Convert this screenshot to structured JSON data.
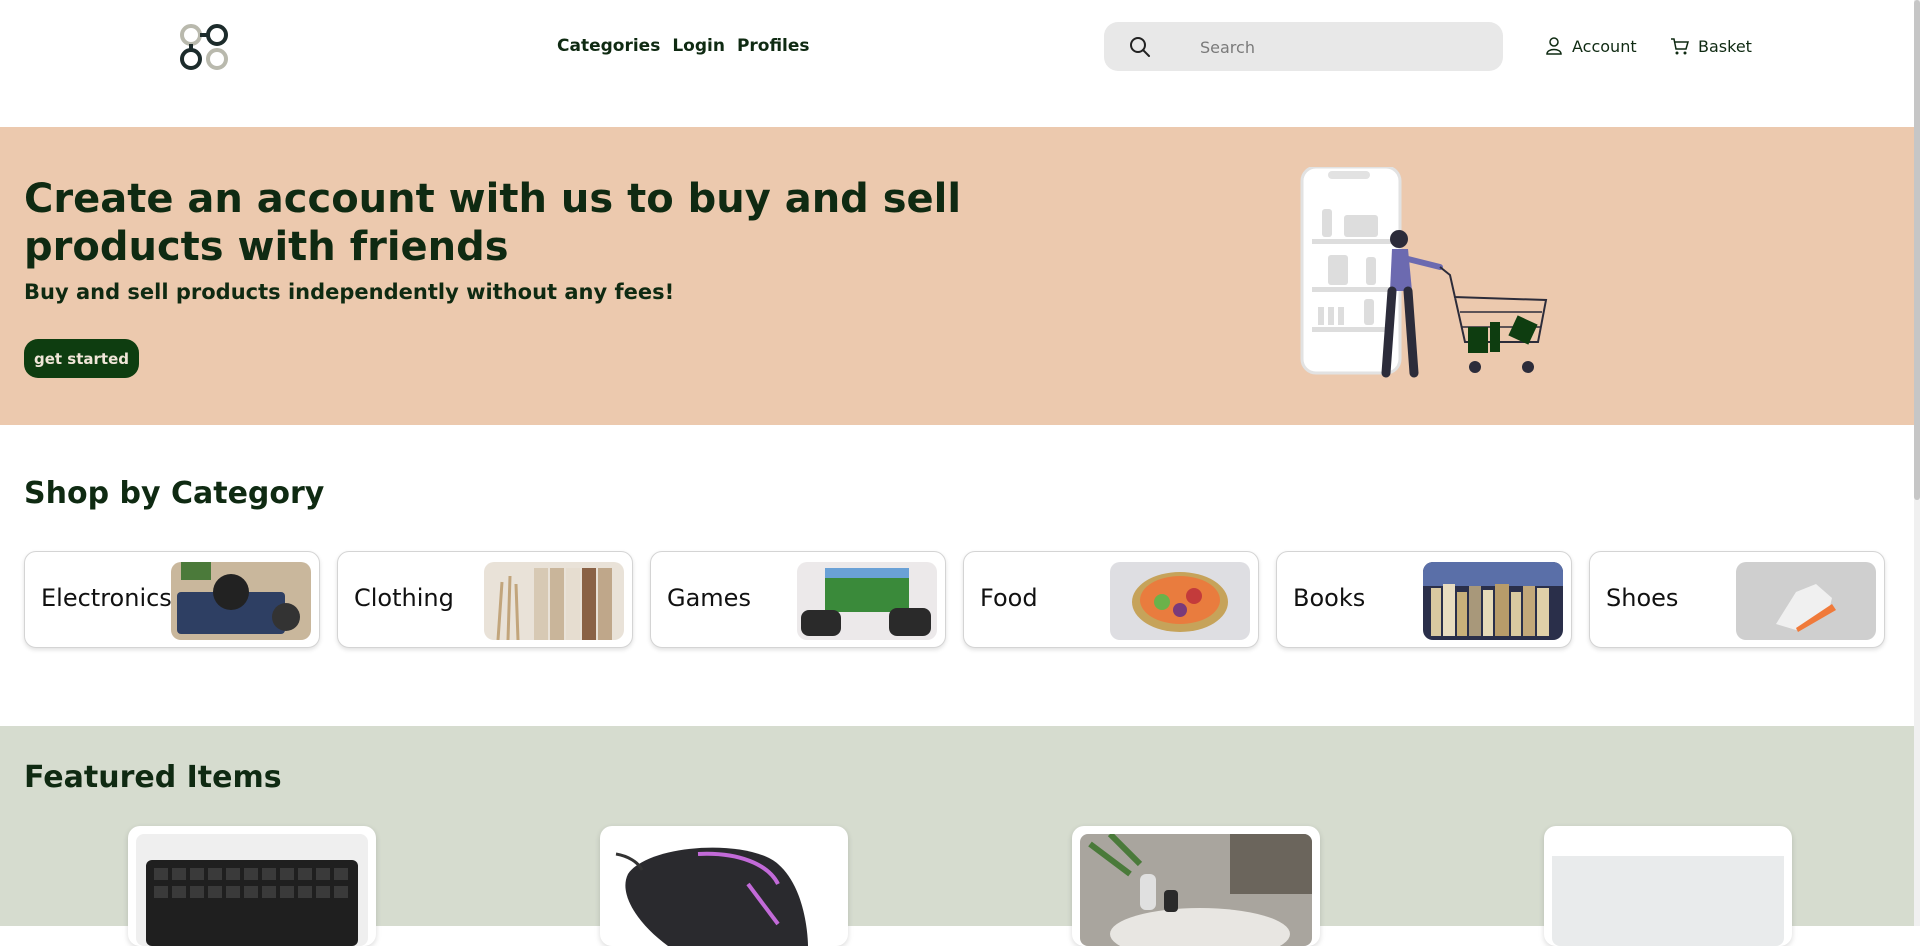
{
  "header": {
    "nav": [
      "Categories",
      "Login",
      "Profiles"
    ],
    "search": {
      "placeholder": "Search",
      "value": ""
    },
    "account_label": "Account",
    "basket_label": "Basket"
  },
  "hero": {
    "title": "Create an account with us to buy and sell products with friends",
    "subtitle": "Buy and sell products independently without any fees!",
    "cta_label": "get started"
  },
  "categories": {
    "title": "Shop by Category",
    "items": [
      {
        "label": "Electronics",
        "image": "headphones-keyboard-photo"
      },
      {
        "label": "Clothing",
        "image": "clothing-rack-photo"
      },
      {
        "label": "Games",
        "image": "gaming-controllers-photo"
      },
      {
        "label": "Food",
        "image": "salad-bowl-photo"
      },
      {
        "label": "Books",
        "image": "bookshelf-photo"
      },
      {
        "label": "Shoes",
        "image": "sneaker-photo"
      }
    ]
  },
  "featured": {
    "title": "Featured Items",
    "items": [
      {
        "image": "keyboard-photo"
      },
      {
        "image": "gaming-mouse-photo"
      },
      {
        "image": "coffee-table-photo"
      },
      {
        "image": "placeholder-image"
      }
    ]
  },
  "colors": {
    "brand_dark": "#0e3d10",
    "hero_bg": "#ecc9ae",
    "featured_bg": "#d6dccf",
    "text": "#0f2a12"
  }
}
